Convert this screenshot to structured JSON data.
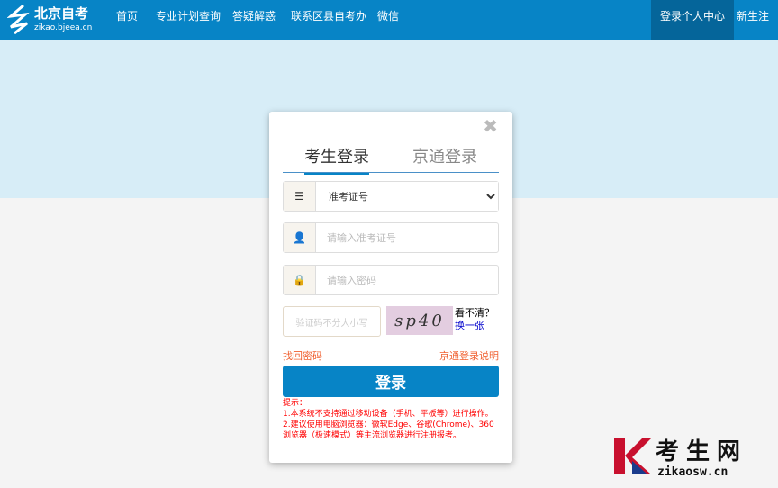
{
  "nav": {
    "logo_title": "北京自考",
    "logo_sub": "zikao.bjeea.cn",
    "items": [
      "首页",
      "专业计划查询",
      "答疑解惑",
      "联系区县自考办",
      "微信"
    ],
    "login_center": "登录个人中心",
    "register": "新生注册"
  },
  "login": {
    "tabs": [
      "考生登录",
      "京通登录"
    ],
    "id_type": "准考证号",
    "id_placeholder": "请输入准考证号",
    "pwd_placeholder": "请输入密码",
    "captcha_placeholder": "验证码不分大小写",
    "captcha_text": "sp40",
    "captcha_hint": "看不清？",
    "captcha_refresh": "换一张",
    "forgot": "找回密码",
    "jingtong_help": "京通登录说明",
    "submit": "登录",
    "tips": [
      "提示：",
      "1.本系统不支持通过移动设备（手机、平板等）进行操作。",
      "2.建议使用电脑浏览器：微软Edge、谷歌(Chrome)、360浏览器（极速模式）等主流浏览器进行注册报考。"
    ]
  },
  "watermark": {
    "text": "考生网",
    "url": "zikaosw.cn"
  },
  "colors": {
    "nav": "#0784c6",
    "accent": "#f06030",
    "tips": "#ff0000"
  }
}
